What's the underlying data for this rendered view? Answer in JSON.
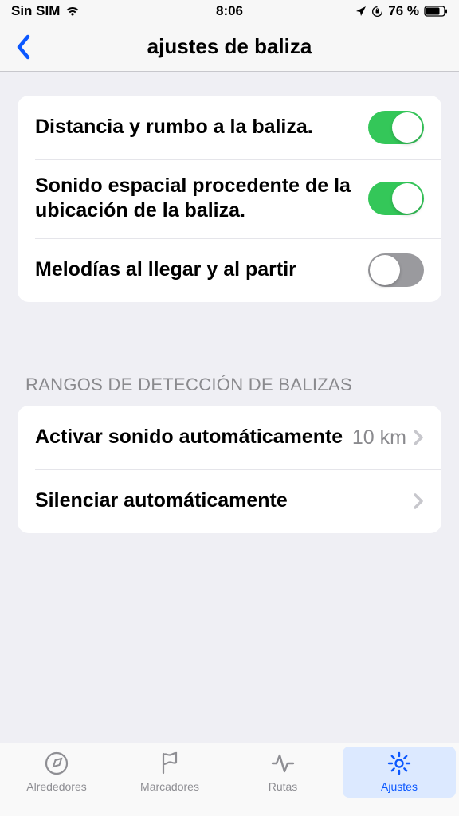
{
  "statusBar": {
    "carrier": "Sin SIM",
    "time": "8:06",
    "battery": "76 %"
  },
  "nav": {
    "title": "ajustes de baliza"
  },
  "section1": {
    "rows": [
      {
        "label": "Distancia y rumbo a la baliza.",
        "state": "on"
      },
      {
        "label": "Sonido espacial procedente de la ubicación de la baliza.",
        "state": "on"
      },
      {
        "label": "Melodías al llegar y al partir",
        "state": "off"
      }
    ]
  },
  "section2": {
    "header": "RANGOS DE DETECCIÓN DE BALIZAS",
    "rows": [
      {
        "label": "Activar sonido automáticamente",
        "value": "10 km"
      },
      {
        "label": "Silenciar automáticamente",
        "value": ""
      }
    ]
  },
  "tabs": [
    {
      "label": "Alrededores"
    },
    {
      "label": "Marcadores"
    },
    {
      "label": "Rutas"
    },
    {
      "label": "Ajustes"
    }
  ]
}
